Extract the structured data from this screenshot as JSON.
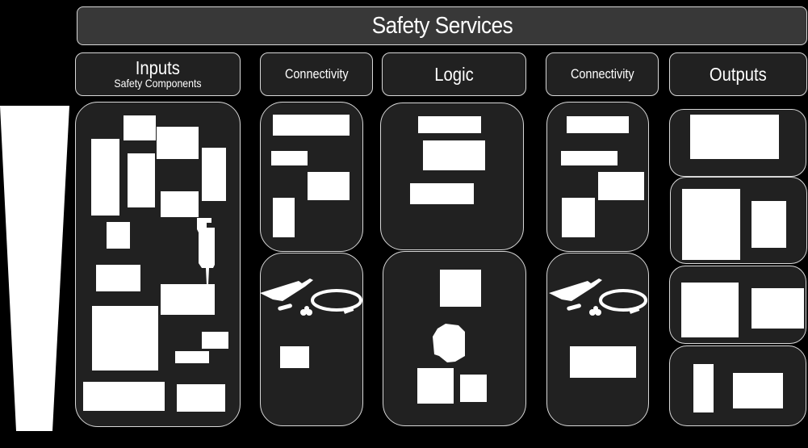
{
  "banner": {
    "title": "Safety Services"
  },
  "columns": [
    {
      "id": "inputs",
      "title": "Inputs",
      "subtitle": "Safety Components"
    },
    {
      "id": "connectivity-left",
      "title": "Connectivity"
    },
    {
      "id": "logic",
      "title": "Logic"
    },
    {
      "id": "connectivity-right",
      "title": "Connectivity"
    },
    {
      "id": "outputs",
      "title": "Outputs"
    }
  ],
  "colors": {
    "background": "#000000",
    "panel": "#212121",
    "banner": "#383838",
    "border": "#d8d8d8",
    "placeholder": "#ffffff"
  },
  "icons": {
    "left_indicator": "tapered-bar-icon",
    "cable": "cable-kit-icon",
    "controller": "controller-icon"
  }
}
